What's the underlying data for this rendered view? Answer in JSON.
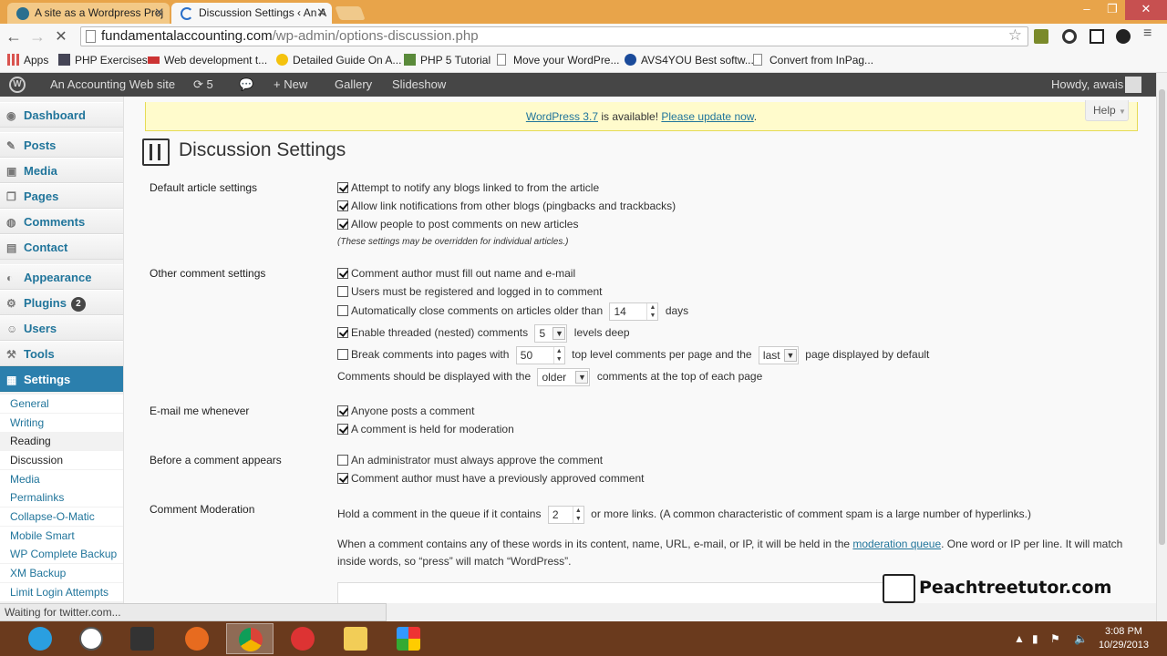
{
  "browser": {
    "tabs": [
      {
        "title": "A site as a Wordpress Proj"
      },
      {
        "title": "Discussion Settings ‹ An A"
      }
    ],
    "tab_close": "✕",
    "url_host": "fundamentalaccounting.com",
    "url_path": "/wp-admin/options-discussion.php",
    "bookmarks": [
      {
        "label": "Apps"
      },
      {
        "label": "PHP Exercises"
      },
      {
        "label": "Web development t..."
      },
      {
        "label": "Detailed Guide On A..."
      },
      {
        "label": "PHP 5 Tutorial"
      },
      {
        "label": "Move your WordPre..."
      },
      {
        "label": "AVS4YOU Best softw..."
      },
      {
        "label": "Convert from InPag..."
      }
    ],
    "status": "Waiting for twitter.com..."
  },
  "adminbar": {
    "site": "An Accounting Web site",
    "updates": "5",
    "new": "New",
    "gallery": "Gallery",
    "slideshow": "Slideshow",
    "howdy": "Howdy, awais"
  },
  "sidebar": {
    "menu": [
      {
        "label": "Dashboard"
      },
      {
        "label": "Posts"
      },
      {
        "label": "Media"
      },
      {
        "label": "Pages"
      },
      {
        "label": "Comments"
      },
      {
        "label": "Contact"
      },
      {
        "label": "Appearance"
      },
      {
        "label": "Plugins",
        "badge": "2"
      },
      {
        "label": "Users"
      },
      {
        "label": "Tools"
      },
      {
        "label": "Settings"
      }
    ],
    "submenu": [
      {
        "label": "General"
      },
      {
        "label": "Writing"
      },
      {
        "label": "Reading"
      },
      {
        "label": "Discussion"
      },
      {
        "label": "Media"
      },
      {
        "label": "Permalinks"
      },
      {
        "label": "Collapse-O-Matic"
      },
      {
        "label": "Mobile Smart"
      },
      {
        "label": "WP Complete Backup"
      },
      {
        "label": "XM Backup"
      },
      {
        "label": "Limit Login Attempts"
      }
    ]
  },
  "notice": {
    "link1": "WordPress 3.7",
    "text": " is available! ",
    "link2": "Please update now",
    "end": "."
  },
  "help": "Help",
  "page_title": "Discussion Settings",
  "sections": {
    "default": {
      "label": "Default article settings",
      "opts": [
        "Attempt to notify any blogs linked to from the article",
        "Allow link notifications from other blogs (pingbacks and trackbacks)",
        "Allow people to post comments on new articles"
      ],
      "note": "(These settings may be overridden for individual articles.)"
    },
    "other": {
      "label": "Other comment settings",
      "opt1": "Comment author must fill out name and e-mail",
      "opt2": "Users must be registered and logged in to comment",
      "opt3_a": "Automatically close comments on articles older than",
      "opt3_val": "14",
      "opt3_b": "days",
      "opt4_a": "Enable threaded (nested) comments",
      "opt4_val": "5",
      "opt4_b": "levels deep",
      "opt5_a": "Break comments into pages with",
      "opt5_val": "50",
      "opt5_b": "top level comments per page and the",
      "opt5_sel": "last",
      "opt5_c": "page displayed by default",
      "opt6_a": "Comments should be displayed with the",
      "opt6_sel": "older",
      "opt6_b": "comments at the top of each page"
    },
    "email": {
      "label": "E-mail me whenever",
      "opts": [
        "Anyone posts a comment",
        "A comment is held for moderation"
      ]
    },
    "before": {
      "label": "Before a comment appears",
      "opts": [
        "An administrator must always approve the comment",
        "Comment author must have a previously approved comment"
      ]
    },
    "moderation": {
      "label": "Comment Moderation",
      "hold_a": "Hold a comment in the queue if it contains",
      "hold_val": "2",
      "hold_b": "or more links. (A common characteristic of comment spam is a large number of hyperlinks.)",
      "para_a": "When a comment contains any of these words in its content, name, URL, e-mail, or IP, it will be held in the ",
      "para_link": "moderation queue",
      "para_b": ". One word or IP per line. It will match inside words, so “press” will match “WordPress”."
    }
  },
  "watermark": "Peachtreetutor.com",
  "clock": {
    "time": "3:08 PM",
    "date": "10/29/2013"
  },
  "colors": {
    "accent": "#21759b",
    "adminbar": "#464646",
    "active_menu": "#2b7fad"
  }
}
